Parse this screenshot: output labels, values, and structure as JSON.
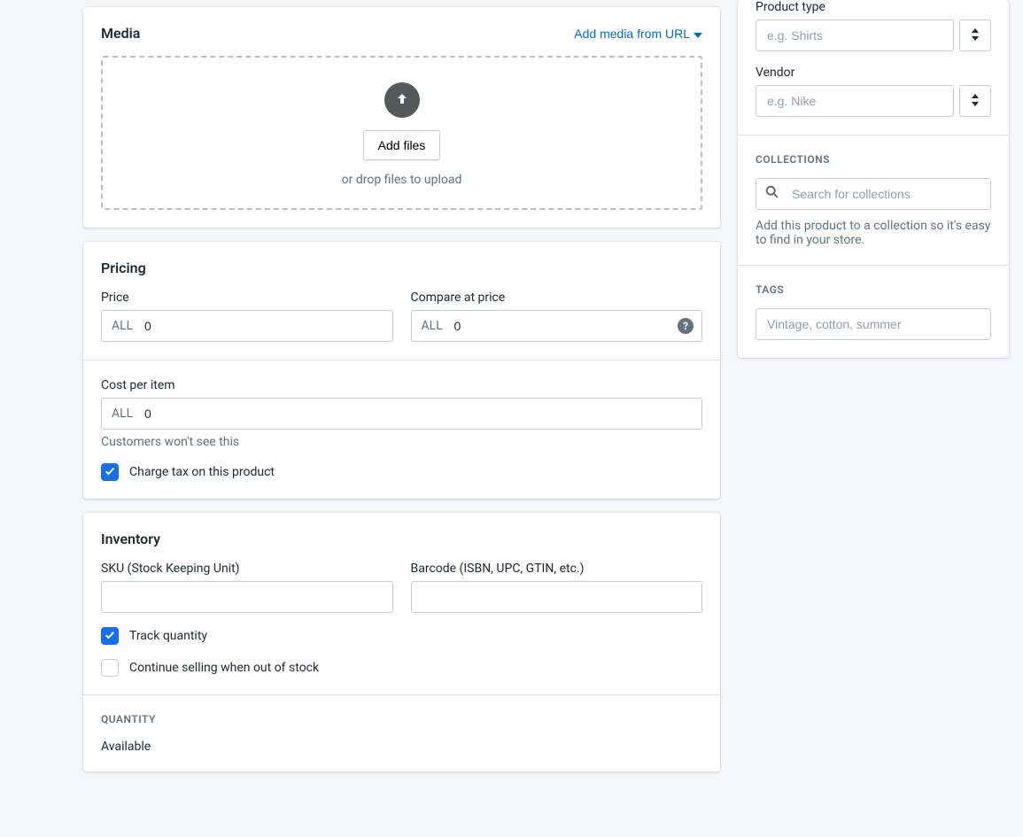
{
  "media": {
    "title": "Media",
    "add_from_url": "Add media from URL",
    "add_files": "Add files",
    "drop_text": "or drop files to upload"
  },
  "pricing": {
    "title": "Pricing",
    "price_label": "Price",
    "price_currency": "ALL",
    "price_value": "0",
    "compare_label": "Compare at price",
    "compare_currency": "ALL",
    "compare_value": "0",
    "cost_label": "Cost per item",
    "cost_currency": "ALL",
    "cost_value": "0",
    "cost_help": "Customers won't see this",
    "charge_tax_label": "Charge tax on this product",
    "charge_tax_checked": true
  },
  "inventory": {
    "title": "Inventory",
    "sku_label": "SKU (Stock Keeping Unit)",
    "sku_value": "",
    "barcode_label": "Barcode (ISBN, UPC, GTIN, etc.)",
    "barcode_value": "",
    "track_label": "Track quantity",
    "track_checked": true,
    "continue_label": "Continue selling when out of stock",
    "continue_checked": false,
    "quantity_heading": "QUANTITY",
    "available_label": "Available"
  },
  "organization": {
    "product_type_label": "Product type",
    "product_type_placeholder": "e.g. Shirts",
    "vendor_label": "Vendor",
    "vendor_placeholder": "e.g. Nike"
  },
  "collections": {
    "heading": "COLLECTIONS",
    "search_placeholder": "Search for collections",
    "help": "Add this product to a collection so it's easy to find in your store."
  },
  "tags": {
    "heading": "TAGS",
    "placeholder": "Vintage, cotton, summer"
  }
}
